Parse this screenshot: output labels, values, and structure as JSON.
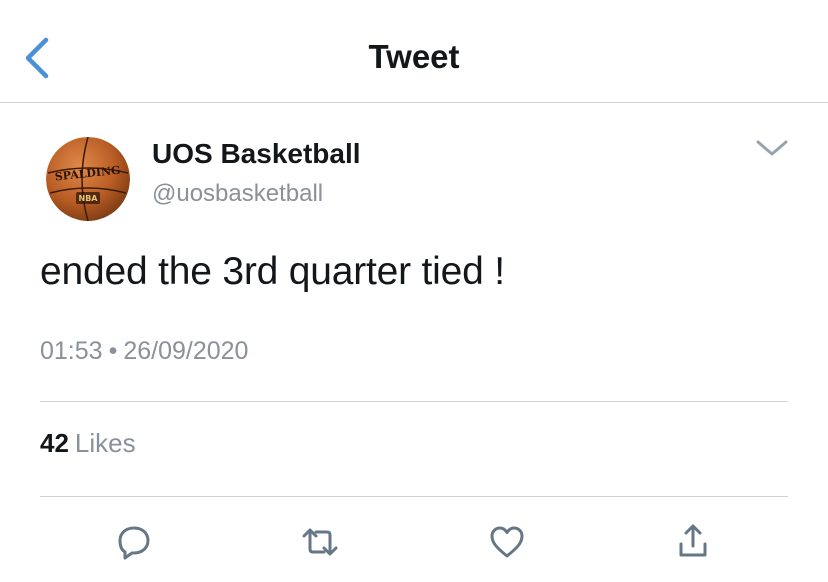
{
  "header": {
    "title": "Tweet"
  },
  "tweet": {
    "author": {
      "display_name": "UOS Basketball",
      "handle": "@uosbasketball"
    },
    "avatar_logo_text": [
      "SPALDING",
      "NBA"
    ],
    "text": "ended the 3rd quarter tied !",
    "time": "01:53",
    "separator": "•",
    "date": "26/09/2020",
    "likes_count": "42",
    "likes_label": "Likes"
  },
  "actions": {
    "icons": [
      "reply-icon",
      "retweet-icon",
      "like-icon",
      "share-icon"
    ]
  },
  "colors": {
    "accent": "#4a90d9",
    "text": "#14171a",
    "secondary_text": "#8a9199",
    "divider": "#cfd3d6",
    "icon": "#657786",
    "basketball": "#c8692c"
  }
}
